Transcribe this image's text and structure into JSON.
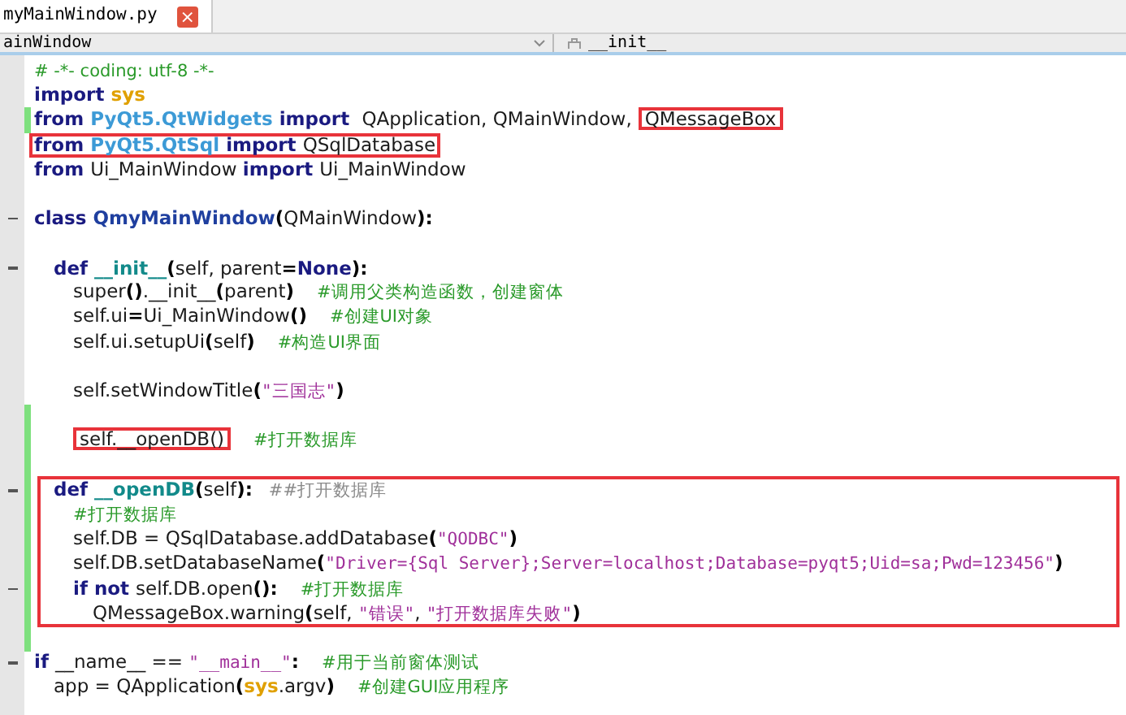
{
  "tab": {
    "title": "myMainWindow.py",
    "close": "×"
  },
  "navigation": {
    "class_combo": "ainWindow",
    "method_combo": "__init__"
  },
  "code": {
    "lines": [
      {
        "fold": false,
        "changed": false,
        "boxed": false,
        "segments": [
          {
            "kind": "cmt",
            "text": "# -*- coding: utf-8 -*-"
          }
        ]
      },
      {
        "fold": false,
        "changed": false,
        "boxed": false,
        "segments": [
          {
            "kind": "kw",
            "text": "import "
          },
          {
            "kind": "builtin",
            "text": "sys"
          }
        ]
      },
      {
        "fold": false,
        "changed": true,
        "boxed": false,
        "segments": [
          {
            "kind": "kw",
            "text": "from "
          },
          {
            "kind": "mod",
            "text": "PyQt5.QtWidgets"
          },
          {
            "kind": "kw",
            "text": " import "
          },
          {
            "kind": "plain",
            "text": " QApplication, QMainWindow,"
          },
          {
            "kind": "plain",
            "text": "QMessageBox",
            "boxed": true
          }
        ]
      },
      {
        "fold": false,
        "changed": false,
        "boxed": true,
        "segments": [
          {
            "kind": "kw",
            "text": "from "
          },
          {
            "kind": "mod",
            "text": "PyQt5.QtSql"
          },
          {
            "kind": "kw",
            "text": " import "
          },
          {
            "kind": "plain",
            "text": "QSqlDatabase"
          }
        ]
      },
      {
        "fold": false,
        "changed": false,
        "boxed": false,
        "segments": [
          {
            "kind": "kw",
            "text": "from "
          },
          {
            "kind": "plain",
            "text": "Ui_MainWindow "
          },
          {
            "kind": "kw",
            "text": "import "
          },
          {
            "kind": "plain",
            "text": "Ui_MainWindow"
          }
        ]
      },
      {
        "fold": false,
        "changed": false,
        "boxed": false
      },
      {
        "fold": true,
        "changed": false,
        "boxed": false,
        "segments": [
          {
            "kind": "kw",
            "text": "class "
          },
          {
            "kind": "cls",
            "text": "QmyMainWindow"
          },
          {
            "kind": "punct",
            "text": "("
          },
          {
            "kind": "plain",
            "text": "QMainWindow"
          },
          {
            "kind": "punct",
            "text": "):"
          }
        ],
        "children": [
          {
            "fold": false,
            "changed": false,
            "boxed": false
          },
          {
            "fold": true,
            "changed": false,
            "boxed": false,
            "segments": [
              {
                "kind": "kw",
                "text": "def "
              },
              {
                "kind": "fn",
                "text": "__init__"
              },
              {
                "kind": "punct",
                "text": "("
              },
              {
                "kind": "plain",
                "text": "self, parent"
              },
              {
                "kind": "punct",
                "text": "="
              },
              {
                "kind": "kw",
                "text": "None"
              },
              {
                "kind": "punct",
                "text": "):"
              }
            ],
            "children": [
              {
                "fold": false,
                "changed": false,
                "boxed": false,
                "segments": [
                  {
                    "kind": "plain",
                    "text": "super"
                  },
                  {
                    "kind": "punct",
                    "text": "()"
                  },
                  {
                    "kind": "plain",
                    "text": ".__init__"
                  },
                  {
                    "kind": "punct",
                    "text": "("
                  },
                  {
                    "kind": "plain",
                    "text": "parent"
                  },
                  {
                    "kind": "punct",
                    "text": ")"
                  },
                  {
                    "kind": "cmt",
                    "text": "#调用父类构造函数，创建窗体"
                  }
                ]
              },
              {
                "fold": false,
                "changed": false,
                "boxed": false,
                "segments": [
                  {
                    "kind": "plain",
                    "text": "self.ui"
                  },
                  {
                    "kind": "punct",
                    "text": "="
                  },
                  {
                    "kind": "plain",
                    "text": "Ui_MainWindow"
                  },
                  {
                    "kind": "punct",
                    "text": "()"
                  },
                  {
                    "kind": "cmt",
                    "text": "#创建UI对象"
                  }
                ]
              },
              {
                "fold": false,
                "changed": false,
                "boxed": false,
                "segments": [
                  {
                    "kind": "plain",
                    "text": "self.ui.setupUi"
                  },
                  {
                    "kind": "punct",
                    "text": "("
                  },
                  {
                    "kind": "plain",
                    "text": "self"
                  },
                  {
                    "kind": "punct",
                    "text": ")"
                  },
                  {
                    "kind": "cmt",
                    "text": "#构造UI界面"
                  }
                ]
              },
              {
                "fold": false,
                "changed": false,
                "boxed": false
              },
              {
                "fold": false,
                "changed": false,
                "boxed": false,
                "segments": [
                  {
                    "kind": "plain",
                    "text": "self.setWindowTitle"
                  },
                  {
                    "kind": "punct",
                    "text": "("
                  },
                  {
                    "kind": "str",
                    "text": "\"三国志\""
                  },
                  {
                    "kind": "punct",
                    "text": ")"
                  }
                ]
              },
              {
                "fold": false,
                "changed": true,
                "boxed": false
              },
              {
                "fold": false,
                "changed": true,
                "boxed": false,
                "segments": [
                  {
                    "kind": "plain",
                    "text": "self.__openDB()",
                    "boxed": true
                  },
                  {
                    "kind": "cmt",
                    "text": "#打开数据库"
                  }
                ]
              },
              {
                "fold": false,
                "changed": true,
                "boxed": false
              }
            ]
          },
          {
            "fold": true,
            "changed": true,
            "boxed": true,
            "segments": [
              {
                "kind": "kw",
                "text": "def "
              },
              {
                "kind": "fn",
                "text": "__openDB"
              },
              {
                "kind": "punct",
                "text": "("
              },
              {
                "kind": "plain",
                "text": "self"
              },
              {
                "kind": "punct",
                "text": "):"
              },
              {
                "kind": "muted",
                "text": "##打开数据库"
              }
            ],
            "children": [
              {
                "fold": false,
                "changed": true,
                "boxed": false,
                "segments": [
                  {
                    "kind": "cmt",
                    "text": "#打开数据库"
                  }
                ]
              },
              {
                "fold": false,
                "changed": true,
                "boxed": false,
                "segments": [
                  {
                    "kind": "plain",
                    "text": "self.DB = QSqlDatabase.addDatabase"
                  },
                  {
                    "kind": "punct",
                    "text": "("
                  },
                  {
                    "kind": "str",
                    "text": "\"QODBC\""
                  },
                  {
                    "kind": "punct",
                    "text": ")"
                  }
                ]
              },
              {
                "fold": false,
                "changed": true,
                "boxed": false,
                "segments": [
                  {
                    "kind": "plain",
                    "text": "self.DB.setDatabaseName"
                  },
                  {
                    "kind": "punct",
                    "text": "("
                  },
                  {
                    "kind": "str",
                    "text": "\"Driver={Sql Server};Server=localhost;Database=pyqt5;Uid=sa;Pwd=123456\""
                  },
                  {
                    "kind": "punct",
                    "text": ")"
                  }
                ]
              },
              {
                "fold": true,
                "changed": true,
                "boxed": false,
                "segments": [
                  {
                    "kind": "kw",
                    "text": "if not "
                  },
                  {
                    "kind": "plain",
                    "text": "self.DB.open"
                  },
                  {
                    "kind": "punct",
                    "text": "():"
                  },
                  {
                    "kind": "cmt",
                    "text": "#打开数据库"
                  }
                ],
                "children": [
                  {
                    "fold": false,
                    "changed": true,
                    "boxed": false,
                    "segments": [
                      {
                        "kind": "plain",
                        "text": "QMessageBox.warning"
                      },
                      {
                        "kind": "punct",
                        "text": "("
                      },
                      {
                        "kind": "plain",
                        "text": "self, "
                      },
                      {
                        "kind": "str",
                        "text": "\"错误\""
                      },
                      {
                        "kind": "plain",
                        "text": ", "
                      },
                      {
                        "kind": "str",
                        "text": "\"打开数据库失败\""
                      },
                      {
                        "kind": "punct",
                        "text": ")"
                      }
                    ]
                  }
                ]
              }
            ]
          }
        ]
      },
      {
        "fold": false,
        "changed": true,
        "boxed": false
      },
      {
        "fold": true,
        "changed": false,
        "boxed": false,
        "segments": [
          {
            "kind": "kw",
            "text": "if "
          },
          {
            "kind": "plain",
            "text": "__name__ == "
          },
          {
            "kind": "str",
            "text": "\"__main__\""
          },
          {
            "kind": "punct",
            "text": ":"
          },
          {
            "kind": "cmt",
            "text": "#用于当前窗体测试"
          }
        ],
        "children": [
          {
            "fold": false,
            "changed": false,
            "boxed": false,
            "segments": [
              {
                "kind": "plain",
                "text": "app = QApplication"
              },
              {
                "kind": "punct",
                "text": "("
              },
              {
                "kind": "builtin",
                "text": "sys"
              },
              {
                "kind": "plain",
                "text": ".argv"
              },
              {
                "kind": "punct",
                "text": ")"
              },
              {
                "kind": "cmt",
                "text": "#创建GUI应用程序"
              }
            ]
          }
        ]
      }
    ]
  }
}
